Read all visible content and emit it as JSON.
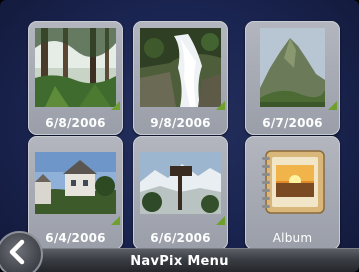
{
  "menu": {
    "title": "NavPix Menu",
    "back_icon": "chevron-left-icon"
  },
  "tiles": [
    {
      "label": "6/8/2006",
      "scene": "forest"
    },
    {
      "label": "9/8/2006",
      "scene": "waterfall"
    },
    {
      "label": "6/7/2006",
      "scene": "mountain"
    },
    {
      "label": "6/4/2006",
      "scene": "house"
    },
    {
      "label": "6/6/2006",
      "scene": "signpost"
    },
    {
      "label": "Album",
      "icon": "album-icon"
    }
  ],
  "colors": {
    "background": "#1a2450",
    "tile": "#a8abb4",
    "corner_flag": "#6fa02e"
  }
}
